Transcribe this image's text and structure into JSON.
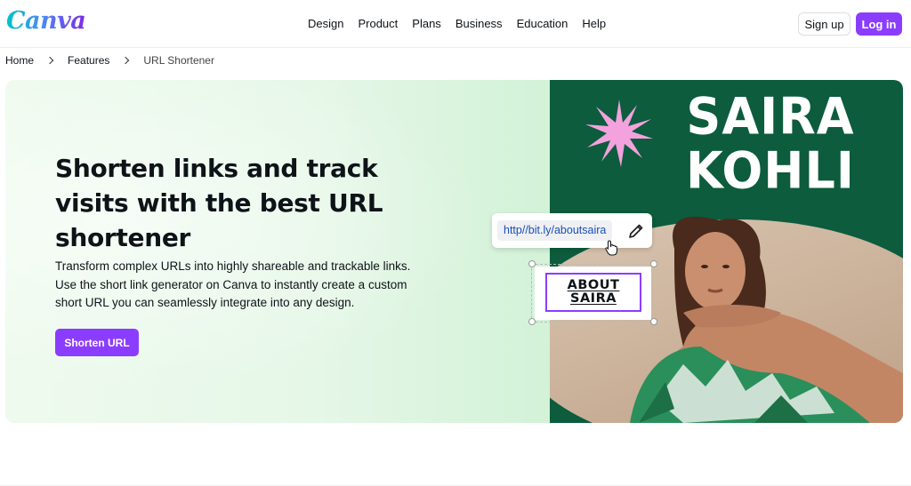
{
  "brand": {
    "logo_text": "Canva",
    "accent": "#8b3dff",
    "hero_dark_green": "#0c5c3d"
  },
  "nav": {
    "items": [
      "Design",
      "Product",
      "Plans",
      "Business",
      "Education",
      "Help"
    ]
  },
  "auth": {
    "signup_label": "Sign up",
    "login_label": "Log in"
  },
  "breadcrumb": {
    "items": [
      "Home",
      "Features",
      "URL Shortener"
    ]
  },
  "hero": {
    "title": "Shorten links and track visits with the best URL shortener",
    "description": "Transform complex URLs into highly shareable and trackable links. Use the short link generator on Canva to instantly create a custom short URL you can seamlessly integrate into any design.",
    "cta_label": "Shorten URL"
  },
  "visual": {
    "name_line1": "SAIRA",
    "name_line2": "KOHLI",
    "link_text": "http//bit.ly/aboutsaira",
    "about_line1": "ABOUT",
    "about_line2": "SAIRA"
  },
  "icons": {
    "edit": "pencil-icon",
    "cursor": "hand-pointer-icon",
    "chevron": "chevron-right-icon",
    "star": "starburst-icon"
  }
}
